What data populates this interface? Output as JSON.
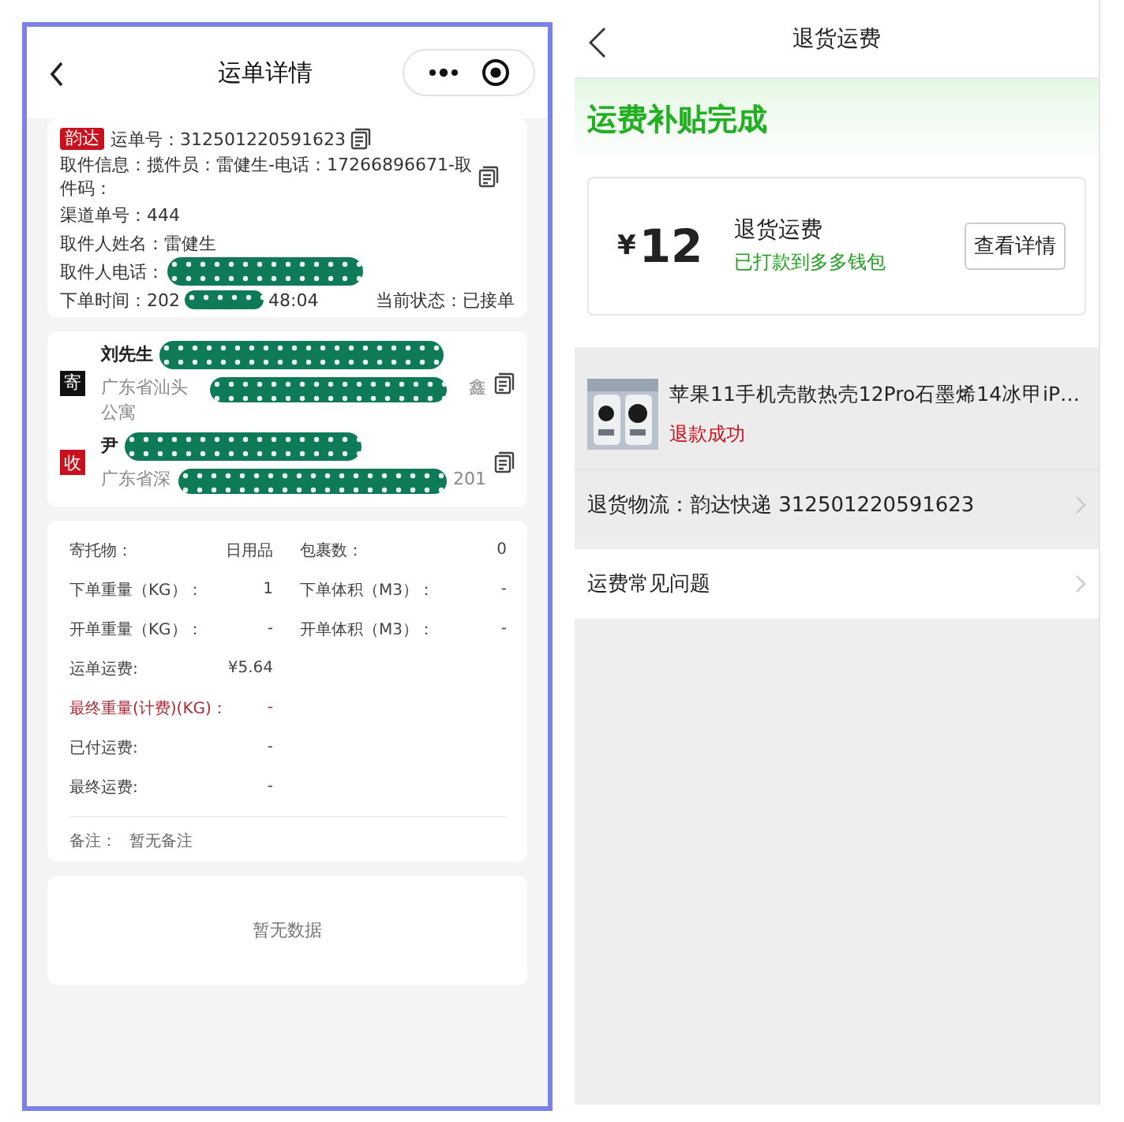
{
  "left": {
    "header": {
      "title": "运单详情"
    },
    "waybill": {
      "carrier": "韵达",
      "number": "运单号：312501220591623",
      "pickup_info": "取件信息：揽件员：雷健生-电话：17266896671-取件码：",
      "channel_no": "渠道单号：444",
      "pickup_name": "取件人姓名：雷健生",
      "pickup_phone_label": "取件人电话：",
      "order_time_head": "下单时间：202",
      "order_time_tail": "48:04",
      "status": "当前状态：已接单"
    },
    "parties": [
      {
        "kind": "sender",
        "badge": "寄",
        "name": "刘先生",
        "address_head": "广东省汕头",
        "address_tail": "鑫",
        "address_line2": "公寓"
      },
      {
        "kind": "receiver",
        "badge": "收",
        "name": "尹",
        "address_head": "广东省深",
        "address_tail": "201"
      }
    ],
    "details": [
      {
        "left": {
          "label": "寄托物：",
          "value": "日用品",
          "highlight": false
        },
        "right": {
          "label": "包裹数：",
          "value": "0",
          "highlight": false
        }
      },
      {
        "left": {
          "label": "下单重量（KG）：",
          "value": "1",
          "highlight": false
        },
        "right": {
          "label": "下单体积（M3）：",
          "value": "-",
          "highlight": false
        }
      },
      {
        "left": {
          "label": "开单重量（KG）：",
          "value": "-",
          "highlight": false
        },
        "right": {
          "label": "开单体积（M3）：",
          "value": "-",
          "highlight": false
        }
      },
      {
        "left": {
          "label": "运单运费:",
          "value": "¥5.64",
          "highlight": false
        }
      },
      {
        "left": {
          "label": "最终重量(计费)(KG)：",
          "value": "-",
          "highlight": true
        }
      },
      {
        "left": {
          "label": "已付运费:",
          "value": "-",
          "highlight": false
        }
      },
      {
        "left": {
          "label": "最终运费:",
          "value": "-",
          "highlight": false
        }
      }
    ],
    "remark": {
      "label": "备注：",
      "value": "暂无备注"
    },
    "empty": "暂无数据"
  },
  "right": {
    "header": {
      "title": "退货运费"
    },
    "banner": "运费补贴完成",
    "refund": {
      "currency": "¥",
      "amount": "12",
      "label": "退货运费",
      "status": "已打款到多多钱包",
      "button": "查看详情"
    },
    "product": {
      "kind": "picture",
      "title": "苹果11手机壳散热壳12Pro石墨烯14冰甲iP…",
      "status": "退款成功"
    },
    "links": [
      {
        "label": "退货物流：韵达快递 312501220591623",
        "highlighted": true
      },
      {
        "label": "运费常见问题",
        "highlighted": false
      }
    ]
  }
}
